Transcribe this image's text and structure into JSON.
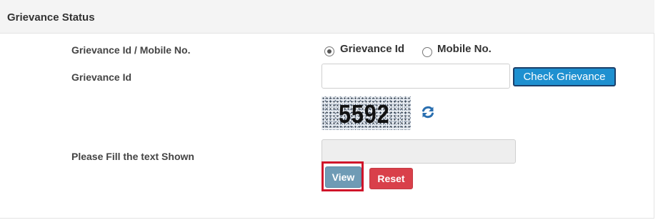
{
  "panel": {
    "title": "Grievance Status"
  },
  "form": {
    "search_by_label": "Grievance Id / Mobile No.",
    "options": [
      {
        "label": "Grievance Id",
        "selected": true
      },
      {
        "label": "Mobile No.",
        "selected": false
      }
    ],
    "grievance_id_label": "Grievance Id",
    "grievance_id_value": "",
    "check_button_label": "Check Grievance",
    "captcha_text": "5592",
    "refresh_icon": "refresh-icon",
    "captcha_prompt_label": "Please Fill the text Shown",
    "captcha_input_value": "",
    "view_button_label": "View",
    "reset_button_label": "Reset"
  },
  "colors": {
    "check_button": "#1e90d0",
    "view_button": "#6f9bb5",
    "reset_button": "#d9404a",
    "highlight_border": "#d0142a"
  }
}
